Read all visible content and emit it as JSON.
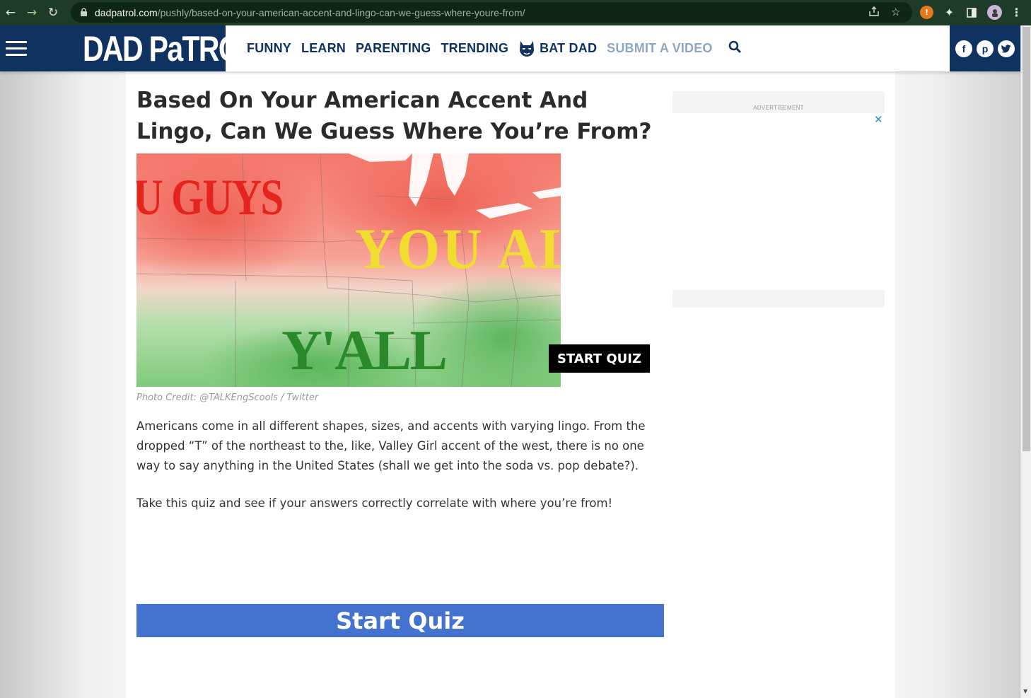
{
  "browser": {
    "url_domain": "dadpatrol.com",
    "url_path": "/pushly/based-on-your-american-accent-and-lingo-can-we-guess-where-youre-from/"
  },
  "site": {
    "logo": "DAD PaTROL",
    "nav": {
      "funny": "FUNNY",
      "learn": "LEARN",
      "parenting": "PARENTING",
      "trending": "TRENDING",
      "bat_dad": "BAT DAD",
      "submit": "SUBMIT A VIDEO"
    },
    "social": {
      "facebook": "f",
      "pinterest": "p",
      "twitter": "t"
    },
    "colors": {
      "brand_navy": "#0f3260",
      "muted_link": "#8ea6c3",
      "quiz_blue": "#4472cf"
    }
  },
  "article": {
    "title": "Based On Your American Accent And Lingo, Can We Guess Where You’re From?",
    "hero_words": {
      "top_left": "U GUYS",
      "middle": "YOU AL",
      "bottom": "Y'ALL"
    },
    "start_badge": "START QUIZ",
    "photo_credit": "Photo Credit: @TALKEngScools / Twitter",
    "paragraphs": [
      "Americans come in all different shapes, sizes, and accents with varying lingo. From the dropped “T” of the northeast to the, like, Valley Girl accent of the west, there is no one way to say anything in the United States (shall we get into the soda vs. pop debate?).",
      "Take this quiz and see if your answers correctly correlate with where you’re from!"
    ],
    "quiz_button": "Start Quiz"
  },
  "sidebar": {
    "ad_label": "ADVERTISEMENT",
    "ad_close": "✕"
  }
}
